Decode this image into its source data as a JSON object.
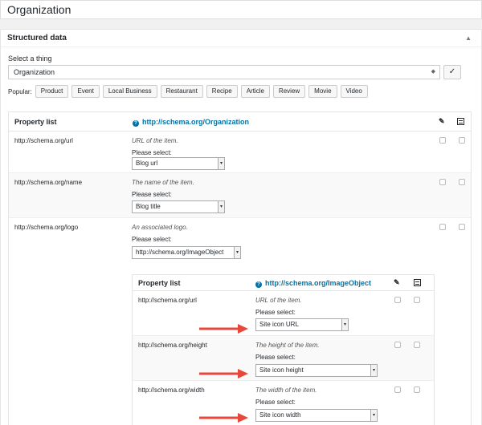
{
  "title": {
    "value": "Organization"
  },
  "structured_data": {
    "heading": "Structured data",
    "select_label": "Select a thing",
    "selected_thing": "Organization",
    "go_label": "✓",
    "popular_label": "Popular:",
    "popular": [
      "Product",
      "Event",
      "Local Business",
      "Restaurant",
      "Recipe",
      "Article",
      "Review",
      "Movie",
      "Video"
    ]
  },
  "property_list": {
    "header": "Property list",
    "schema_url": "http://schema.org/Organization",
    "rows": [
      {
        "name": "http://schema.org/url",
        "description": "URL of the item.",
        "please_select": "Please select:",
        "value": "Blog url"
      },
      {
        "name": "http://schema.org/name",
        "description": "The name of the item.",
        "please_select": "Please select:",
        "value": "Blog title"
      },
      {
        "name": "http://schema.org/logo",
        "description": "An associated logo.",
        "please_select": "Please select:",
        "value": "http://schema.org/ImageObject"
      }
    ]
  },
  "nested_list": {
    "header": "Property list",
    "schema_url": "http://schema.org/ImageObject",
    "rows": [
      {
        "name": "http://schema.org/url",
        "description": "URL of the item.",
        "please_select": "Please select:",
        "value": "Site icon URL"
      },
      {
        "name": "http://schema.org/height",
        "description": "The height of the item.",
        "please_select": "Please select:",
        "value": "Site icon height"
      },
      {
        "name": "http://schema.org/width",
        "description": "The width of the item.",
        "please_select": "Please select:",
        "value": "Site icon width"
      }
    ]
  },
  "colors": {
    "link": "#0073aa",
    "annotation_arrow": "#e8483b"
  }
}
